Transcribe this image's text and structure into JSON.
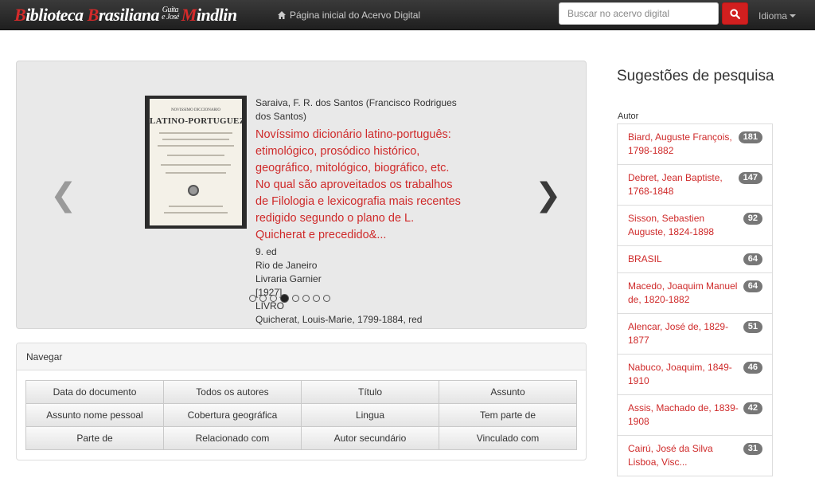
{
  "header": {
    "brand": {
      "biblioteca_cap": "B",
      "biblioteca_rest": "iblioteca",
      "brasiliana_cap": "B",
      "brasiliana_rest": "rasiliana",
      "guita": "Guita",
      "ejose": "e José",
      "mindlin_cap": "M",
      "mindlin_rest": "indlin"
    },
    "home_label": "Página inicial do Acervo Digital",
    "search_placeholder": "Buscar no acervo digital",
    "language_label": "Idioma"
  },
  "carousel": {
    "author": "Saraiva, F. R. dos Santos (Francisco Rodrigues dos Santos)",
    "title": "Novíssimo dicionário latino-português: etimológico, prosódico histórico, geográfico, mitológico, biográfico, etc. No qual são aproveitados os trabalhos de Filologia e lexicografia mais recentes redigido segundo o plano de L. Quicherat e precedido&...",
    "edition": "9. ed",
    "place": "Rio de Janeiro",
    "publisher": "Livraria Garnier",
    "year": "[1927]",
    "type": "LIVRO",
    "related": "Quicherat, Louis-Marie, 1799-1884, red",
    "cover_small": "NOVISSIMO DICCIONARIO",
    "cover_title": "LATINO-PORTUGUEZ",
    "slide_count": 8,
    "active_slide": 3
  },
  "navegar": {
    "heading": "Navegar",
    "buttons": [
      "Data do documento",
      "Todos os autores",
      "Título",
      "Assunto",
      "Assunto nome pessoal",
      "Cobertura geográfica",
      "Lingua",
      "Tem parte de",
      "Parte de",
      "Relacionado com",
      "Autor secundário",
      "Vinculado com"
    ]
  },
  "suggestions": {
    "heading": "Sugestões de pesquisa",
    "facet_label": "Autor",
    "items": [
      {
        "label": "Biard, Auguste François, 1798-1882",
        "count": "181"
      },
      {
        "label": "Debret, Jean Baptiste, 1768-1848",
        "count": "147"
      },
      {
        "label": "Sisson, Sebastien Auguste, 1824-1898",
        "count": "92"
      },
      {
        "label": "BRASIL",
        "count": "64"
      },
      {
        "label": "Macedo, Joaquim Manuel de, 1820-1882",
        "count": "64"
      },
      {
        "label": "Alencar, José de, 1829-1877",
        "count": "51"
      },
      {
        "label": "Nabuco, Joaquim, 1849-1910",
        "count": "46"
      },
      {
        "label": "Assis, Machado de, 1839-1908",
        "count": "42"
      },
      {
        "label": "Cairú, José da Silva Lisboa, Visc...",
        "count": "31"
      }
    ]
  },
  "colors": {
    "accent": "#cf2a2a",
    "search_button": "#d11f1f",
    "navbar": "#2a2a2a",
    "badge": "#777777"
  }
}
